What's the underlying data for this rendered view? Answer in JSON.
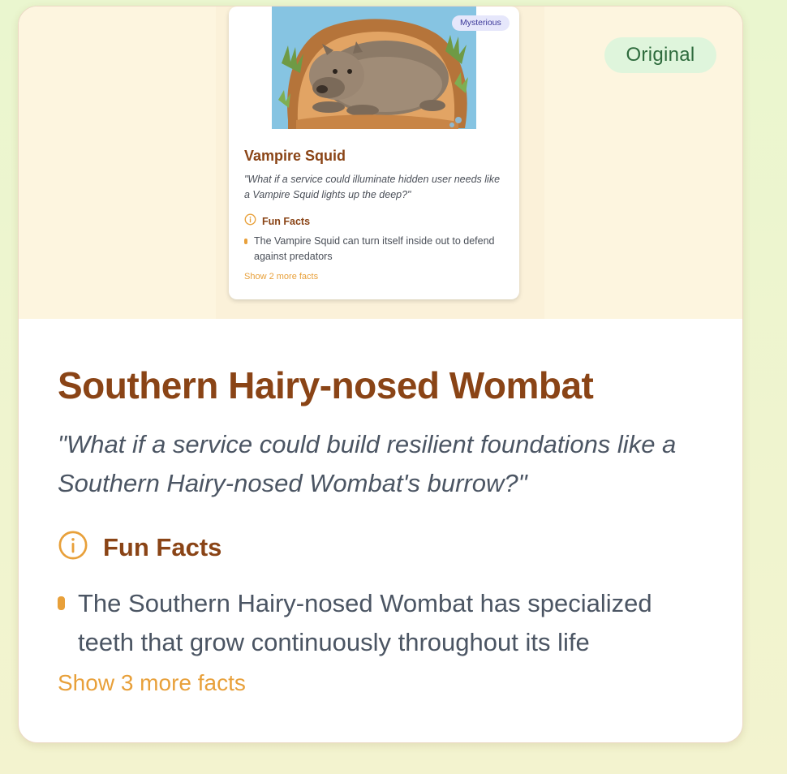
{
  "badge": {
    "label": "Original"
  },
  "preview": {
    "tag": "Mysterious",
    "title": "Vampire Squid",
    "quote": "\"What if a service could illuminate hidden user needs like a Vampire Squid lights up the deep?\"",
    "facts_heading": "Fun Facts",
    "facts": [
      "The Vampire Squid can turn itself inside out to defend against predators"
    ],
    "more_link": "Show 2 more facts"
  },
  "main": {
    "title": "Southern Hairy-nosed Wombat",
    "quote": "\"What if a service could build resilient foundations like a Southern Hairy-nosed Wombat's burrow?\"",
    "facts_heading": "Fun Facts",
    "facts": [
      "The Southern Hairy-nosed Wombat has specialized teeth that grow continuously throughout its life"
    ],
    "more_link": "Show 3 more facts"
  },
  "colors": {
    "title": "#8a4416",
    "accent": "#e8a03a",
    "badge_bg": "#dff5dc",
    "badge_text": "#2e6b3d",
    "tag_bg": "#e6e7fb",
    "tag_text": "#3d3a9a"
  },
  "icons": {
    "facts": "info-circle-icon",
    "bullet": "bullet-dot-icon"
  }
}
